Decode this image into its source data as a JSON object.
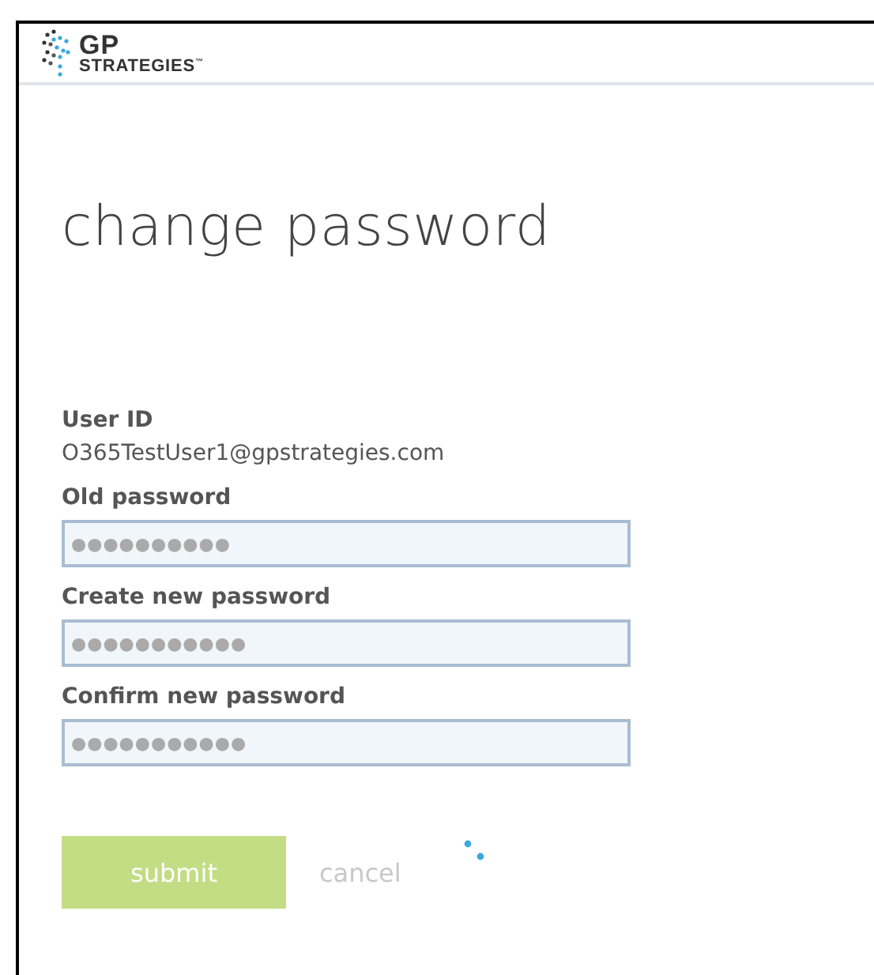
{
  "header": {
    "logo": {
      "line_1": "GP",
      "line_2": "STRATEGIES",
      "mark": "™"
    }
  },
  "title": "change password",
  "user_id": {
    "label": "User ID",
    "value": "O365TestUser1@gpstrategies.com"
  },
  "fields": [
    {
      "label": "Old password",
      "value": "●●●●●●●●●●"
    },
    {
      "label": "Create new password",
      "value": "●●●●●●●●●●●"
    },
    {
      "label": "Confirm new password",
      "value": "●●●●●●●●●●●"
    }
  ],
  "buttons": {
    "submit": "submit",
    "cancel": "cancel"
  },
  "busy": true
}
